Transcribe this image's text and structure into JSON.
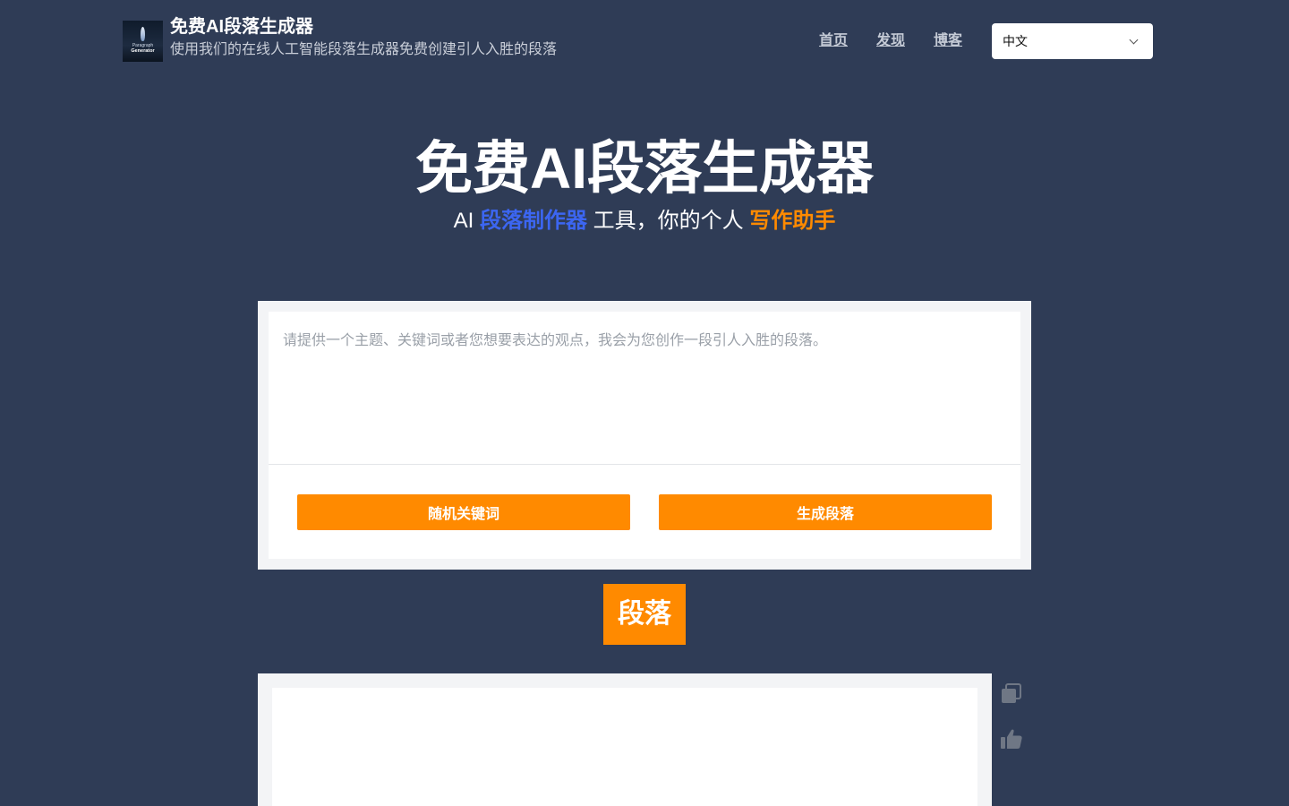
{
  "header": {
    "logo_line1": "Paragraph",
    "logo_line2": "Generator",
    "title": "免费AI段落生成器",
    "subtitle": "使用我们的在线人工智能段落生成器免费创建引人入胜的段落",
    "nav": [
      {
        "label": "首页"
      },
      {
        "label": "发现"
      },
      {
        "label": "博客"
      }
    ],
    "language": "中文"
  },
  "hero": {
    "title": "免费AI段落生成器",
    "sub_prefix": "AI ",
    "sub_highlight_blue": "段落制作器",
    "sub_middle": " 工具，你的个人 ",
    "sub_highlight_orange": "写作助手"
  },
  "input": {
    "placeholder": "请提供一个主题、关键词或者您想要表达的观点，我会为您创作一段引人入胜的段落。",
    "random_button": "随机关键词",
    "generate_button": "生成段落"
  },
  "output": {
    "badge": "段落"
  },
  "colors": {
    "background": "#2f3c56",
    "accent_orange": "#ff8a00",
    "accent_blue": "#3c66f2"
  },
  "icons": [
    "copy-icon",
    "thumbs-up-icon",
    "chevron-down-icon"
  ]
}
